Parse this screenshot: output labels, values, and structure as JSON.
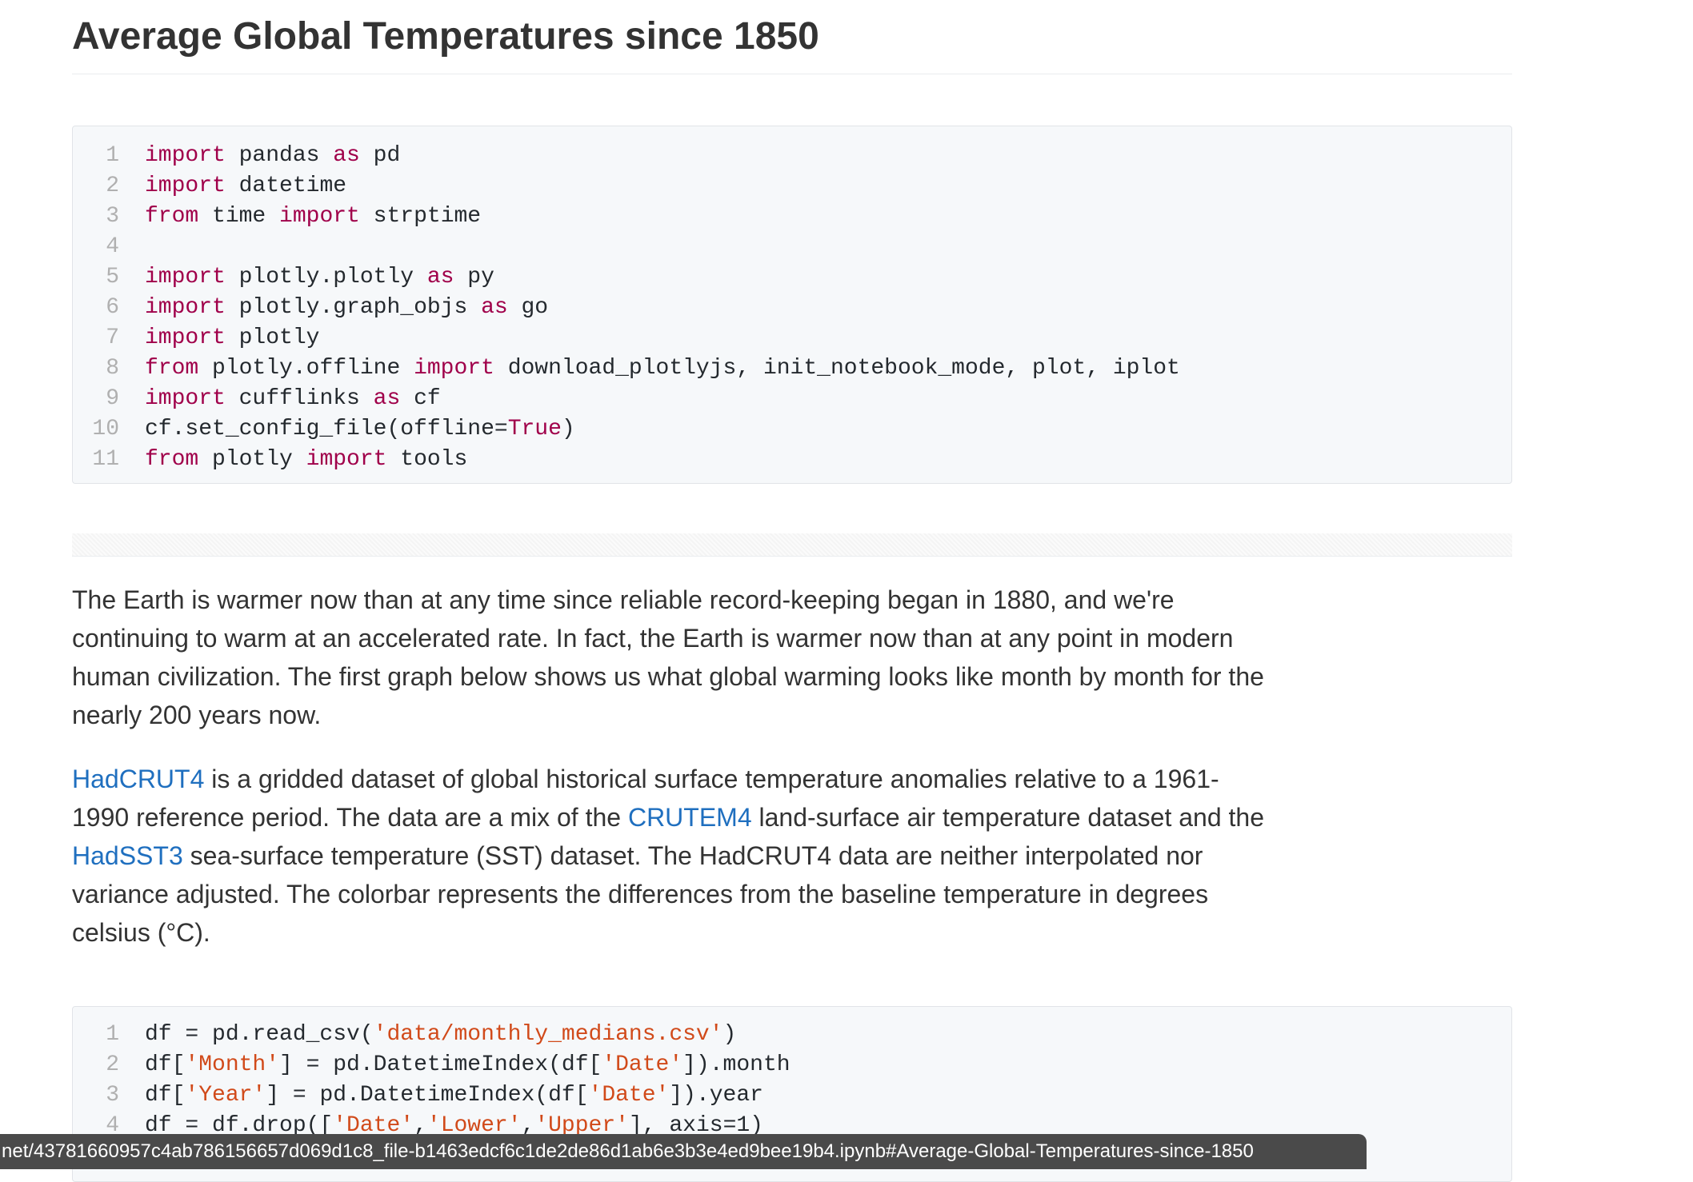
{
  "page": {
    "title": "Average Global Temperatures since 1850"
  },
  "code_cell_1": [
    {
      "n": "1",
      "tokens": [
        {
          "t": "import",
          "c": "kw"
        },
        {
          "t": " pandas "
        },
        {
          "t": "as",
          "c": "kw"
        },
        {
          "t": " pd"
        }
      ]
    },
    {
      "n": "2",
      "tokens": [
        {
          "t": "import",
          "c": "kw"
        },
        {
          "t": " datetime"
        }
      ]
    },
    {
      "n": "3",
      "tokens": [
        {
          "t": "from",
          "c": "kw"
        },
        {
          "t": " time "
        },
        {
          "t": "import",
          "c": "kw"
        },
        {
          "t": " strptime"
        }
      ]
    },
    {
      "n": "4",
      "tokens": []
    },
    {
      "n": "5",
      "tokens": [
        {
          "t": "import",
          "c": "kw"
        },
        {
          "t": " plotly.plotly "
        },
        {
          "t": "as",
          "c": "kw"
        },
        {
          "t": " py"
        }
      ]
    },
    {
      "n": "6",
      "tokens": [
        {
          "t": "import",
          "c": "kw"
        },
        {
          "t": " plotly.graph_objs "
        },
        {
          "t": "as",
          "c": "kw"
        },
        {
          "t": " go"
        }
      ]
    },
    {
      "n": "7",
      "tokens": [
        {
          "t": "import",
          "c": "kw"
        },
        {
          "t": " plotly"
        }
      ]
    },
    {
      "n": "8",
      "tokens": [
        {
          "t": "from",
          "c": "kw"
        },
        {
          "t": " plotly.offline "
        },
        {
          "t": "import",
          "c": "kw"
        },
        {
          "t": " download_plotlyjs, init_notebook_mode, plot, iplot"
        }
      ]
    },
    {
      "n": "9",
      "tokens": [
        {
          "t": "import",
          "c": "kw"
        },
        {
          "t": " cufflinks "
        },
        {
          "t": "as",
          "c": "kw"
        },
        {
          "t": " cf"
        }
      ]
    },
    {
      "n": "10",
      "tokens": [
        {
          "t": "cf.set_config_file(offline="
        },
        {
          "t": "True",
          "c": "kw"
        },
        {
          "t": ")"
        }
      ]
    },
    {
      "n": "11",
      "tokens": [
        {
          "t": "from",
          "c": "kw"
        },
        {
          "t": " plotly "
        },
        {
          "t": "import",
          "c": "kw"
        },
        {
          "t": " tools"
        }
      ]
    }
  ],
  "paragraph_1": "The Earth is warmer now than at any time since reliable record-keeping began in 1880, and we're continuing to warm at an accelerated rate. In fact, the Earth is warmer now than at any point in modern human civilization. The first graph below shows us what global warming looks like month by month for the nearly 200 years now.",
  "paragraph_2": {
    "link_hadcrut4": "HadCRUT4",
    "text_a": " is a gridded dataset of global historical surface temperature anomalies relative to a 1961-1990 reference period. The data are a mix of the ",
    "link_crutem4": "CRUTEM4",
    "text_b": " land-surface air temperature dataset and the ",
    "link_hadsst3": "HadSST3",
    "text_c": " sea-surface temperature (SST) dataset. The HadCRUT4 data are neither interpolated nor variance adjusted. The colorbar represents the differences from the baseline temperature in degrees celsius (°C)."
  },
  "code_cell_2": [
    {
      "n": "1",
      "tokens": [
        {
          "t": "df = pd.read_csv("
        },
        {
          "t": "'data/monthly_medians.csv'",
          "c": "str"
        },
        {
          "t": ")"
        }
      ]
    },
    {
      "n": "2",
      "tokens": [
        {
          "t": "df["
        },
        {
          "t": "'Month'",
          "c": "str"
        },
        {
          "t": "] = pd.DatetimeIndex(df["
        },
        {
          "t": "'Date'",
          "c": "str"
        },
        {
          "t": "]).month"
        }
      ]
    },
    {
      "n": "3",
      "tokens": [
        {
          "t": "df["
        },
        {
          "t": "'Year'",
          "c": "str"
        },
        {
          "t": "] = pd.DatetimeIndex(df["
        },
        {
          "t": "'Date'",
          "c": "str"
        },
        {
          "t": "]).year"
        }
      ]
    },
    {
      "n": "4",
      "tokens": [
        {
          "t": "df = df.drop(["
        },
        {
          "t": "'Date'",
          "c": "str"
        },
        {
          "t": ","
        },
        {
          "t": "'Lower'",
          "c": "str"
        },
        {
          "t": ","
        },
        {
          "t": "'Upper'",
          "c": "str"
        },
        {
          "t": "], axis=1)"
        }
      ]
    }
  ],
  "status_bar": {
    "url": "net/43781660957c4ab786156657d069d1c8_file-b1463edcf6c1de2de86d1ab6e3b3e4ed9bee19b4.ipynb#Average-Global-Temperatures-since-1850"
  },
  "colors": {
    "keyword": "#a0004a",
    "string": "#d14a1a",
    "link": "#1f6fbf",
    "code_bg": "#f6f8fa"
  }
}
